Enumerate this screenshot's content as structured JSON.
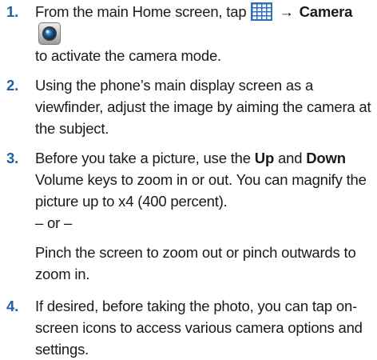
{
  "steps": [
    {
      "number": "1.",
      "text_a": "From the main Home screen, tap",
      "arrow": "→",
      "bold_a": "Camera",
      "text_b": "to activate the camera mode."
    },
    {
      "number": "2.",
      "text_a": "Using the phone’s main display screen as a viewfinder, adjust the image by aiming the camera at the subject."
    },
    {
      "number": "3.",
      "text_a": "Before you take a picture, use the",
      "bold_a": "Up",
      "text_b": "and",
      "bold_b": "Down",
      "text_c": "Volume keys to zoom in or out. You can magnify the picture up to x4 (400 percent).",
      "or_text": "– or –",
      "alt_text": "Pinch the screen to zoom out or pinch outwards to zoom in."
    },
    {
      "number": "4.",
      "text_a": "If desired, before taking the photo, you can tap on-screen icons to access various camera options and settings."
    }
  ],
  "icons": {
    "apps": "apps-grid-icon",
    "camera": "camera-app-icon"
  },
  "colors": {
    "step_number": "#1f5fa8",
    "apps_icon": "#2a6fc0",
    "text": "#1a1a1a"
  }
}
